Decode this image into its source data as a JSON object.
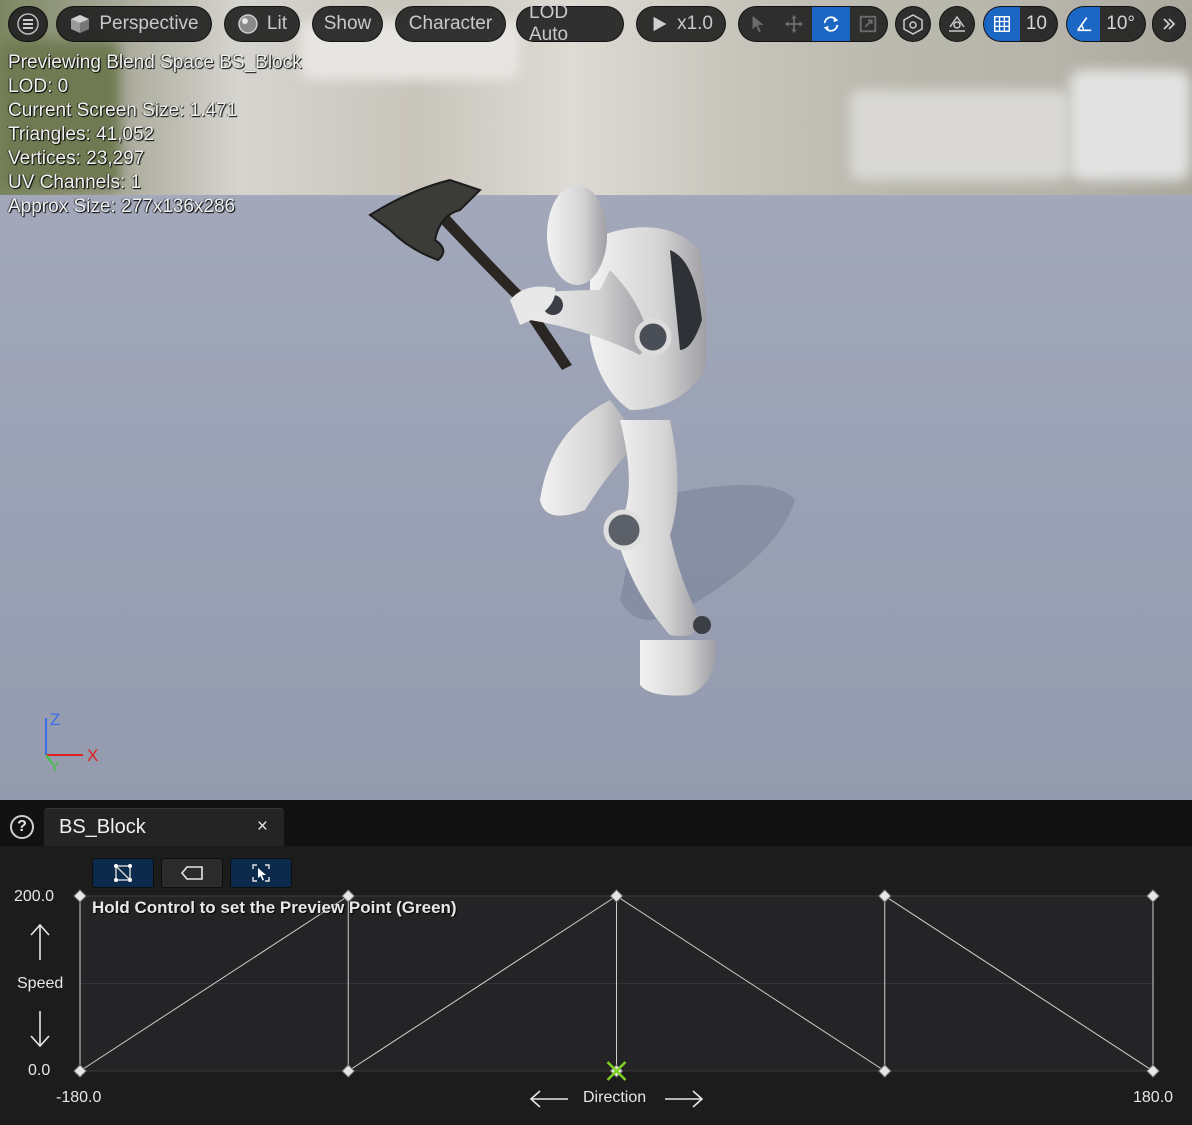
{
  "toolbar": {
    "menu_icon": "hamburger-icon",
    "perspective": "Perspective",
    "lit": "Lit",
    "show": "Show",
    "character": "Character",
    "lod": "LOD Auto",
    "play_speed": "x1.0",
    "grid_snap_value": "10",
    "rotation_snap_value": "10°",
    "more_icon": "double-chevron-right-icon"
  },
  "stats": {
    "line1": "Previewing Blend Space BS_Block",
    "line2": "LOD: 0",
    "line3": "Current Screen Size: 1.471",
    "line4": "Triangles: 41,052",
    "line5": "Vertices: 23,297",
    "line6": "UV Channels: 1",
    "line7": "Approx Size: 277x136x286"
  },
  "axes": {
    "z": "Z",
    "y": "Y",
    "x": "X"
  },
  "colors": {
    "accent": "#1c66c4",
    "preview_point": "#7ed321",
    "axis_x": "#e02020",
    "axis_y": "#40c040",
    "axis_z": "#3a6cf0"
  },
  "panel": {
    "tab_label": "BS_Block",
    "close_glyph": "×",
    "help_glyph": "?",
    "hint": "Hold Control to set the Preview Point (Green)",
    "y_max": "200.0",
    "y_min": "0.0",
    "y_axis_label": "Speed",
    "x_min": "-180.0",
    "x_max": "180.0",
    "x_axis_label": "Direction"
  },
  "blend_space": {
    "x_range": [
      -180,
      180
    ],
    "y_range": [
      0,
      200
    ],
    "samples": [
      {
        "x": -180,
        "y": 0
      },
      {
        "x": -90,
        "y": 0
      },
      {
        "x": 0,
        "y": 0
      },
      {
        "x": 90,
        "y": 0
      },
      {
        "x": 180,
        "y": 0
      },
      {
        "x": -180,
        "y": 200
      },
      {
        "x": -90,
        "y": 200
      },
      {
        "x": 0,
        "y": 200
      },
      {
        "x": 90,
        "y": 200
      },
      {
        "x": 180,
        "y": 200
      }
    ],
    "preview_point": {
      "x": 0,
      "y": 0
    }
  }
}
